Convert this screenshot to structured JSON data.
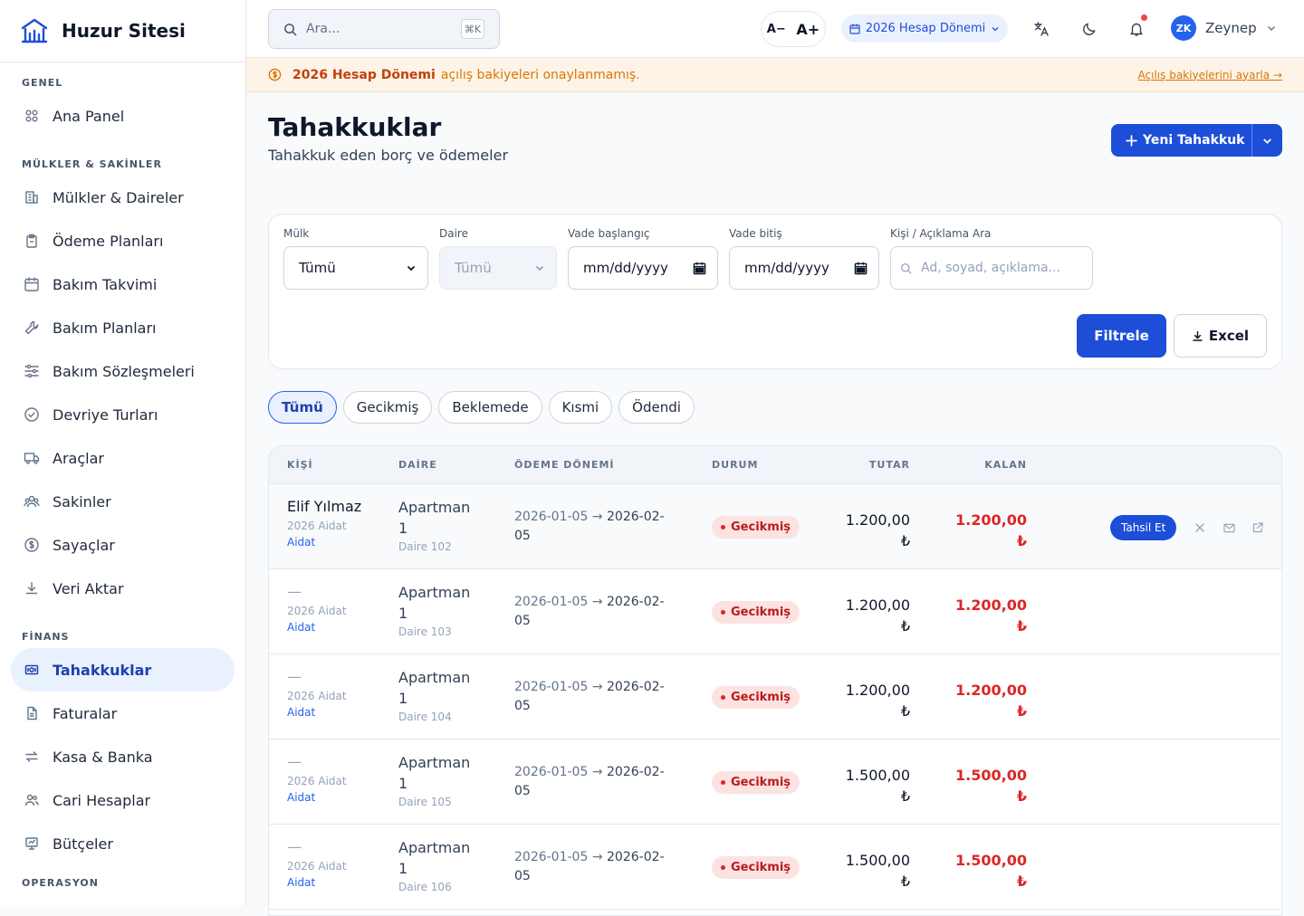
{
  "brand": {
    "name": "Huzur Sitesi"
  },
  "sidebar": {
    "sections": [
      {
        "title": "GENEL",
        "items": [
          {
            "label": "Ana Panel",
            "icon": "grid-icon"
          }
        ]
      },
      {
        "title": "MÜLKLER & SAKİNLER",
        "items": [
          {
            "label": "Mülkler & Daireler",
            "icon": "building-icon"
          },
          {
            "label": "Ödeme Planları",
            "icon": "clipboard-icon"
          },
          {
            "label": "Bakım Takvimi",
            "icon": "calendar-icon"
          },
          {
            "label": "Bakım Planları",
            "icon": "wrench-icon"
          },
          {
            "label": "Bakım Sözleşmeleri",
            "icon": "sliders-icon"
          },
          {
            "label": "Devriye Turları",
            "icon": "check-circle-icon"
          },
          {
            "label": "Araçlar",
            "icon": "truck-icon"
          },
          {
            "label": "Sakinler",
            "icon": "users-icon"
          },
          {
            "label": "Sayaçlar",
            "icon": "coin-icon"
          },
          {
            "label": "Veri Aktar",
            "icon": "download-icon"
          }
        ]
      },
      {
        "title": "FİNANS",
        "items": [
          {
            "label": "Tahakkuklar",
            "icon": "receipt-icon",
            "active": true
          },
          {
            "label": "Faturalar",
            "icon": "file-icon"
          },
          {
            "label": "Kasa & Banka",
            "icon": "swap-icon"
          },
          {
            "label": "Cari Hesaplar",
            "icon": "user-group-icon"
          },
          {
            "label": "Bütçeler",
            "icon": "budget-icon"
          }
        ]
      },
      {
        "title": "OPERASYON",
        "items": []
      }
    ]
  },
  "topbar": {
    "search_placeholder": "Ara...",
    "search_shortcut": "⌘K",
    "font_decrease": "A−",
    "font_increase": "A+",
    "period_label": "2026 Hesap Dönemi",
    "user_initials": "ZK",
    "user_name": "Zeynep"
  },
  "banner": {
    "highlight": "2026 Hesap Dönemi",
    "text": "açılış bakiyeleri onaylanmamış.",
    "link": "Açılış bakiyelerini ayarla →"
  },
  "page": {
    "title": "Tahakkuklar",
    "subtitle": "Tahakkuk eden borç ve ödemeler",
    "new_button": "Yeni Tahakkuk"
  },
  "filters": {
    "mulk_label": "Mülk",
    "mulk_value": "Tümü",
    "daire_label": "Daire",
    "daire_value": "Tümü",
    "vade_baslangic_label": "Vade başlangıç",
    "vade_baslangic_value": "mm/dd/yyyy",
    "vade_bitis_label": "Vade bitiş",
    "vade_bitis_value": "mm/dd/yyyy",
    "search_label": "Kişi / Açıklama Ara",
    "search_placeholder": "Ad, soyad, açıklama...",
    "filter_button": "Filtrele",
    "excel_button": "Excel"
  },
  "status_tabs": [
    {
      "label": "Tümü",
      "active": true
    },
    {
      "label": "Gecikmiş"
    },
    {
      "label": "Beklemede"
    },
    {
      "label": "Kısmi"
    },
    {
      "label": "Ödendi"
    }
  ],
  "table": {
    "columns": {
      "kisi": "KİŞİ",
      "daire": "DAİRE",
      "donem": "ÖDEME DÖNEMİ",
      "durum": "DURUM",
      "tutar": "TUTAR",
      "kalan": "KALAN"
    },
    "rows": [
      {
        "kisi": "Elif Yılmaz",
        "desc1": "2026 Aidat",
        "desc2": "Aidat",
        "daire_1": "Apartman",
        "daire_2": "1",
        "daire_no": "Daire 102",
        "donem_start": "2026-01-05",
        "arrow": "→",
        "donem_end_1": "2026-02-",
        "donem_end_2": "05",
        "durum": "Gecikmiş",
        "tutar": "1.200,00",
        "kalan": "1.200,00",
        "currency": "₺",
        "action": "Tahsil Et"
      },
      {
        "kisi": "—",
        "desc1": "2026 Aidat",
        "desc2": "Aidat",
        "daire_1": "Apartman",
        "daire_2": "1",
        "daire_no": "Daire 103",
        "donem_start": "2026-01-05",
        "arrow": "→",
        "donem_end_1": "2026-02-",
        "donem_end_2": "05",
        "durum": "Gecikmiş",
        "tutar": "1.200,00",
        "kalan": "1.200,00",
        "currency": "₺"
      },
      {
        "kisi": "—",
        "desc1": "2026 Aidat",
        "desc2": "Aidat",
        "daire_1": "Apartman",
        "daire_2": "1",
        "daire_no": "Daire 104",
        "donem_start": "2026-01-05",
        "arrow": "→",
        "donem_end_1": "2026-02-",
        "donem_end_2": "05",
        "durum": "Gecikmiş",
        "tutar": "1.200,00",
        "kalan": "1.200,00",
        "currency": "₺"
      },
      {
        "kisi": "—",
        "desc1": "2026 Aidat",
        "desc2": "Aidat",
        "daire_1": "Apartman",
        "daire_2": "1",
        "daire_no": "Daire 105",
        "donem_start": "2026-01-05",
        "arrow": "→",
        "donem_end_1": "2026-02-",
        "donem_end_2": "05",
        "durum": "Gecikmiş",
        "tutar": "1.500,00",
        "kalan": "1.500,00",
        "currency": "₺"
      },
      {
        "kisi": "—",
        "desc1": "2026 Aidat",
        "desc2": "Aidat",
        "daire_1": "Apartman",
        "daire_2": "1",
        "daire_no": "Daire 106",
        "donem_start": "2026-01-05",
        "arrow": "→",
        "donem_end_1": "2026-02-",
        "donem_end_2": "05",
        "durum": "Gecikmiş",
        "tutar": "1.500,00",
        "kalan": "1.500,00",
        "currency": "₺"
      }
    ]
  },
  "colors": {
    "accent": "#1d4ed8",
    "danger": "#dc2626",
    "warning_bg": "#fdf3e6"
  }
}
